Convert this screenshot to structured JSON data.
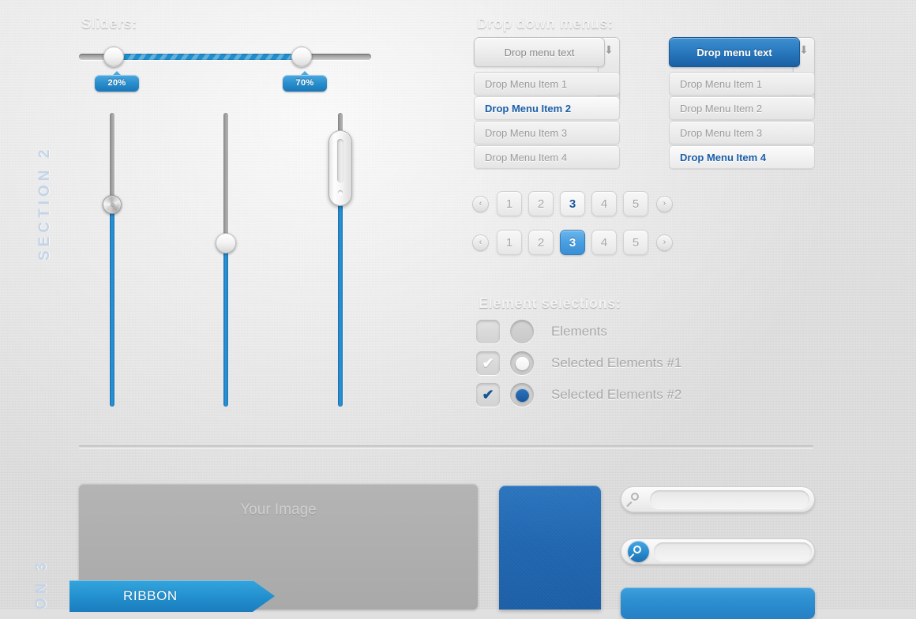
{
  "sections": {
    "side_label_2": "SECTION 2",
    "side_label_3": "ON 3",
    "sliders_title": "Sliders:",
    "dropdowns_title": "Drop down menus:",
    "selections_title": "Element selections:"
  },
  "colors": {
    "accent_blue": "#2a8ecd",
    "dark_blue": "#1f66b0",
    "selected_text_blue": "#1b5ea8",
    "page_bg": "#dcdcdc",
    "side_label": "#c3d4e8"
  },
  "horizontal_slider": {
    "left_badge": "20%",
    "right_badge": "70%",
    "left_value": 20,
    "right_value": 70,
    "min": 0,
    "max": 100
  },
  "vertical_sliders": [
    {
      "name": "metal-knob-slider",
      "value": 70,
      "handle": "metal-dial"
    },
    {
      "name": "round-knob-slider",
      "value": 57,
      "handle": "round-ball"
    },
    {
      "name": "capsule-knob-slider",
      "value": 87,
      "handle": "capsule"
    }
  ],
  "dropdowns": [
    {
      "style": "light",
      "header": "Drop menu text",
      "arrow_icon": "⬇",
      "items": [
        {
          "label": "Drop Menu Item 1",
          "selected": false
        },
        {
          "label": "Drop Menu Item 2",
          "selected": true
        },
        {
          "label": "Drop Menu Item 3",
          "selected": false
        },
        {
          "label": "Drop Menu Item 4",
          "selected": false
        }
      ]
    },
    {
      "style": "blue",
      "header": "Drop menu text",
      "arrow_icon": "⬇",
      "items": [
        {
          "label": "Drop Menu Item 1",
          "selected": false
        },
        {
          "label": "Drop Menu Item 2",
          "selected": false
        },
        {
          "label": "Drop Menu Item 3",
          "selected": false
        },
        {
          "label": "Drop Menu Item 4",
          "selected": true
        }
      ]
    }
  ],
  "pagination": [
    {
      "variant": "text-highlight",
      "prev_icon": "‹",
      "next_icon": "›",
      "pages": [
        "1",
        "2",
        "3",
        "4",
        "5"
      ],
      "current": "3"
    },
    {
      "variant": "filled-highlight",
      "prev_icon": "‹",
      "next_icon": "›",
      "pages": [
        "1",
        "2",
        "3",
        "4",
        "5"
      ],
      "current": "3"
    }
  ],
  "selection_rows": [
    {
      "label": "Elements",
      "checked": false,
      "radio": "empty",
      "check_icon": ""
    },
    {
      "label": "Selected Elements #1",
      "checked": true,
      "radio": "white",
      "check_icon": "✔"
    },
    {
      "label": "Selected Elements #2",
      "checked": true,
      "radio": "blue",
      "check_icon": "✔"
    }
  ],
  "image_block": {
    "placeholder_text": "Your Image",
    "ribbon_text": "RIBBON"
  },
  "search_bars": [
    {
      "icon": "search-icon-plain",
      "value": "",
      "placeholder": ""
    },
    {
      "icon": "search-icon-button",
      "value": "",
      "placeholder": ""
    }
  ]
}
